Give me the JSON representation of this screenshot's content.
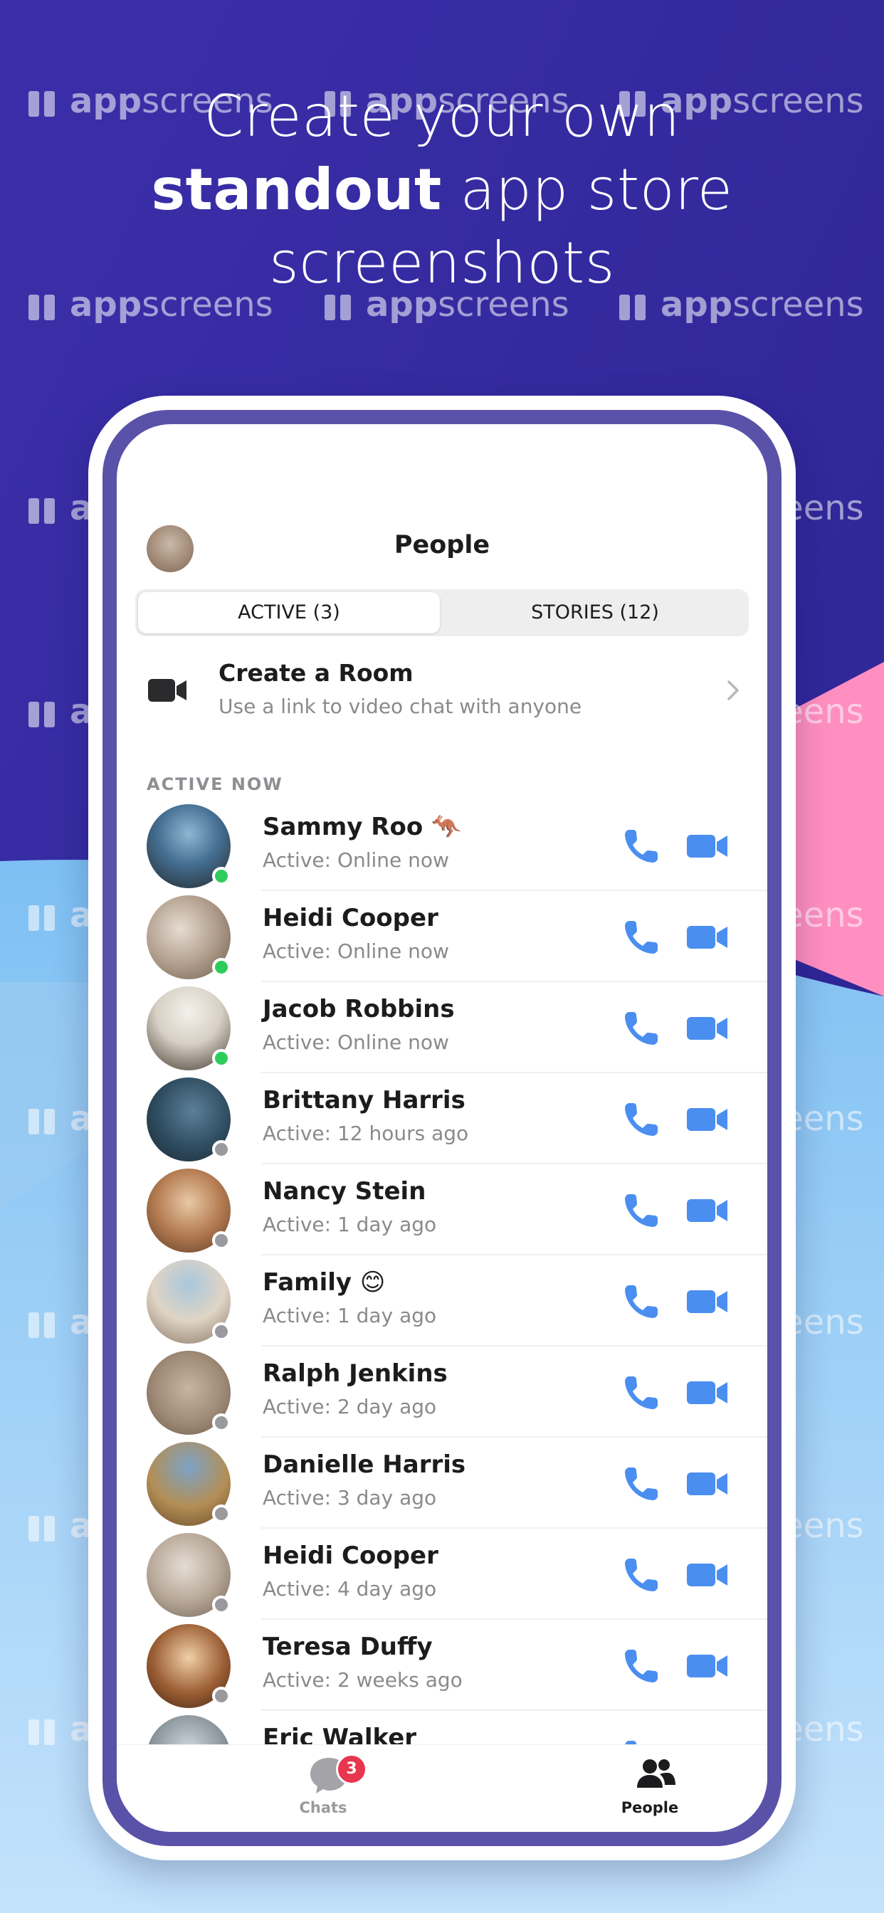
{
  "headline": {
    "line1": "Create your own",
    "line2_bold": "standout",
    "line2_rest": " app store",
    "line3": "screenshots"
  },
  "watermark": {
    "bold": "app",
    "rest": "screens"
  },
  "colors": {
    "bg_purple": "#3a2fa8",
    "bg_pink": "#ff8fc0",
    "bg_light_blue": "#a9d3f5",
    "accent_blue": "#4a8ef0",
    "online_green": "#2ecc5c",
    "offline_gray": "#9a9a9e",
    "badge_red": "#e8364f"
  },
  "header": {
    "title": "People"
  },
  "segments": {
    "active": "ACTIVE (3)",
    "stories": "STORIES (12)"
  },
  "create_room": {
    "title": "Create a Room",
    "subtitle": "Use a link to video chat with anyone",
    "icon": "video-camera-icon"
  },
  "section_label": "ACTIVE NOW",
  "contacts": [
    {
      "name": "Sammy Roo 🦘",
      "status": "Active: Online now",
      "online": true
    },
    {
      "name": "Heidi Cooper",
      "status": "Active: Online now",
      "online": true
    },
    {
      "name": "Jacob Robbins",
      "status": "Active: Online now",
      "online": true
    },
    {
      "name": "Brittany Harris",
      "status": "Active: 12 hours ago",
      "online": false
    },
    {
      "name": "Nancy Stein",
      "status": "Active: 1 day ago",
      "online": false
    },
    {
      "name": "Family 😊",
      "status": "Active: 1 day ago",
      "online": false
    },
    {
      "name": "Ralph Jenkins",
      "status": "Active: 2 day ago",
      "online": false
    },
    {
      "name": "Danielle Harris",
      "status": "Active: 3 day ago",
      "online": false
    },
    {
      "name": "Heidi Cooper",
      "status": "Active: 4 day ago",
      "online": false
    },
    {
      "name": "Teresa Duffy",
      "status": "Active: 2 weeks ago",
      "online": false
    },
    {
      "name": "Eric Walker",
      "status": "",
      "online": false
    }
  ],
  "tabbar": {
    "chats_label": "Chats",
    "chats_badge": "3",
    "people_label": "People"
  }
}
